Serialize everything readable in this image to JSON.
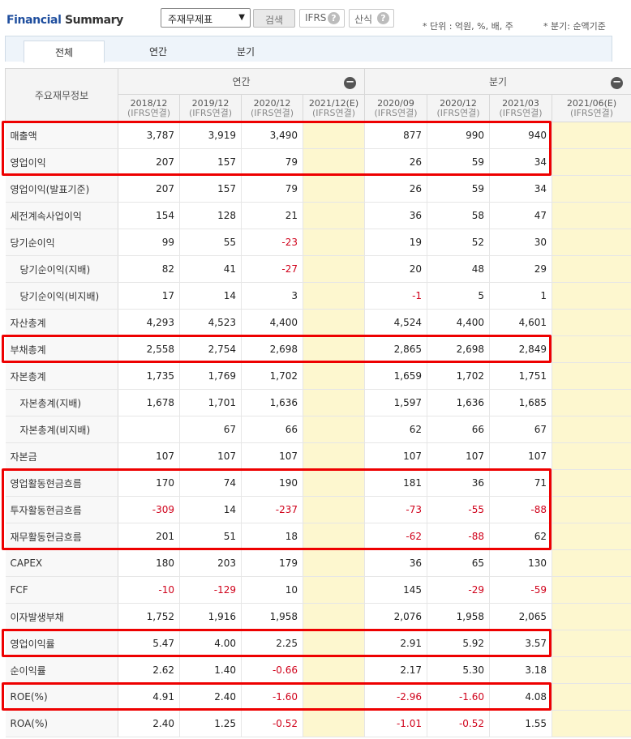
{
  "header": {
    "title_part1": "Financial",
    "title_part2": "Summary",
    "statement_select": "주재무제표",
    "search_label": "검색",
    "ifrs_label": "IFRS",
    "calc_label": "산식",
    "help_glyph": "?",
    "unit_note": "* 단위 : 억원, %, 배, 주",
    "basis_note": "* 분기: 순액기준"
  },
  "tabs": {
    "all": "전체",
    "annual": "연간",
    "quarterly": "분기"
  },
  "table": {
    "corner_label": "주요재무정보",
    "group_annual": "연간",
    "group_quarterly": "분기",
    "collapse_glyph": "−",
    "periods": [
      {
        "date": "2018/12",
        "basis": "(IFRS연결)"
      },
      {
        "date": "2019/12",
        "basis": "(IFRS연결)"
      },
      {
        "date": "2020/12",
        "basis": "(IFRS연결)"
      },
      {
        "date": "2021/12(E)",
        "basis": "(IFRS연결)"
      },
      {
        "date": "2020/09",
        "basis": "(IFRS연결)"
      },
      {
        "date": "2020/12",
        "basis": "(IFRS연결)"
      },
      {
        "date": "2021/03",
        "basis": "(IFRS연결)"
      },
      {
        "date": "2021/06(E)",
        "basis": "(IFRS연결)"
      }
    ],
    "rows": [
      {
        "label": "매출액",
        "indent": false,
        "highlight": true,
        "values": [
          "3,787",
          "3,919",
          "3,490",
          "",
          "877",
          "990",
          "940",
          ""
        ]
      },
      {
        "label": "영업이익",
        "indent": false,
        "highlight": true,
        "values": [
          "207",
          "157",
          "79",
          "",
          "26",
          "59",
          "34",
          ""
        ]
      },
      {
        "label": "영업이익(발표기준)",
        "indent": false,
        "highlight": false,
        "values": [
          "207",
          "157",
          "79",
          "",
          "26",
          "59",
          "34",
          ""
        ]
      },
      {
        "label": "세전계속사업이익",
        "indent": false,
        "highlight": false,
        "values": [
          "154",
          "128",
          "21",
          "",
          "36",
          "58",
          "47",
          ""
        ]
      },
      {
        "label": "당기순이익",
        "indent": false,
        "highlight": false,
        "values": [
          "99",
          "55",
          "-23",
          "",
          "19",
          "52",
          "30",
          ""
        ]
      },
      {
        "label": "당기순이익(지배)",
        "indent": true,
        "highlight": false,
        "values": [
          "82",
          "41",
          "-27",
          "",
          "20",
          "48",
          "29",
          ""
        ]
      },
      {
        "label": "당기순이익(비지배)",
        "indent": true,
        "highlight": false,
        "values": [
          "17",
          "14",
          "3",
          "",
          "-1",
          "5",
          "1",
          ""
        ]
      },
      {
        "label": "자산총계",
        "indent": false,
        "highlight": false,
        "values": [
          "4,293",
          "4,523",
          "4,400",
          "",
          "4,524",
          "4,400",
          "4,601",
          ""
        ]
      },
      {
        "label": "부채총계",
        "indent": false,
        "highlight": true,
        "values": [
          "2,558",
          "2,754",
          "2,698",
          "",
          "2,865",
          "2,698",
          "2,849",
          ""
        ]
      },
      {
        "label": "자본총계",
        "indent": false,
        "highlight": false,
        "values": [
          "1,735",
          "1,769",
          "1,702",
          "",
          "1,659",
          "1,702",
          "1,751",
          ""
        ]
      },
      {
        "label": "자본총계(지배)",
        "indent": true,
        "highlight": false,
        "values": [
          "1,678",
          "1,701",
          "1,636",
          "",
          "1,597",
          "1,636",
          "1,685",
          ""
        ]
      },
      {
        "label": "자본총계(비지배)",
        "indent": true,
        "highlight": false,
        "values": [
          "",
          "67",
          "66",
          "",
          "62",
          "66",
          "67",
          ""
        ]
      },
      {
        "label": "자본금",
        "indent": false,
        "highlight": false,
        "values": [
          "107",
          "107",
          "107",
          "",
          "107",
          "107",
          "107",
          ""
        ]
      },
      {
        "label": "영업활동현금흐름",
        "indent": false,
        "highlight": true,
        "values": [
          "170",
          "74",
          "190",
          "",
          "181",
          "36",
          "71",
          ""
        ]
      },
      {
        "label": "투자활동현금흐름",
        "indent": false,
        "highlight": true,
        "values": [
          "-309",
          "14",
          "-237",
          "",
          "-73",
          "-55",
          "-88",
          ""
        ]
      },
      {
        "label": "재무활동현금흐름",
        "indent": false,
        "highlight": true,
        "values": [
          "201",
          "51",
          "18",
          "",
          "-62",
          "-88",
          "62",
          ""
        ]
      },
      {
        "label": "CAPEX",
        "indent": false,
        "highlight": false,
        "values": [
          "180",
          "203",
          "179",
          "",
          "36",
          "65",
          "130",
          ""
        ]
      },
      {
        "label": "FCF",
        "indent": false,
        "highlight": false,
        "values": [
          "-10",
          "-129",
          "10",
          "",
          "145",
          "-29",
          "-59",
          ""
        ]
      },
      {
        "label": "이자발생부채",
        "indent": false,
        "highlight": false,
        "values": [
          "1,752",
          "1,916",
          "1,958",
          "",
          "2,076",
          "1,958",
          "2,065",
          ""
        ]
      },
      {
        "label": "영업이익률",
        "indent": false,
        "highlight": true,
        "values": [
          "5.47",
          "4.00",
          "2.25",
          "",
          "2.91",
          "5.92",
          "3.57",
          ""
        ]
      },
      {
        "label": "순이익률",
        "indent": false,
        "highlight": false,
        "values": [
          "2.62",
          "1.40",
          "-0.66",
          "",
          "2.17",
          "5.30",
          "3.18",
          ""
        ]
      },
      {
        "label": "ROE(%)",
        "indent": false,
        "highlight": true,
        "values": [
          "4.91",
          "2.40",
          "-1.60",
          "",
          "-2.96",
          "-1.60",
          "4.08",
          ""
        ]
      },
      {
        "label": "ROA(%)",
        "indent": false,
        "highlight": false,
        "values": [
          "2.40",
          "1.25",
          "-0.52",
          "",
          "-1.01",
          "-0.52",
          "1.55",
          ""
        ]
      }
    ]
  },
  "colors": {
    "negative": "#d0021b",
    "estimate_bg": "#fdf7cf",
    "highlight": "#ee0000",
    "title_blue": "#1f4e9e"
  }
}
